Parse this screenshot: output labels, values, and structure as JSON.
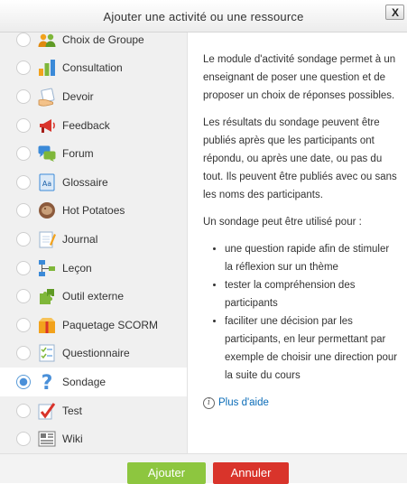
{
  "dialog": {
    "title": "Ajouter une activité ou une ressource",
    "close_label": "X"
  },
  "items": [
    {
      "label": "Choix de Groupe",
      "icon": "group-choice-icon",
      "selected": false
    },
    {
      "label": "Consultation",
      "icon": "bar-chart-icon",
      "selected": false
    },
    {
      "label": "Devoir",
      "icon": "hand-paper-icon",
      "selected": false
    },
    {
      "label": "Feedback",
      "icon": "megaphone-icon",
      "selected": false
    },
    {
      "label": "Forum",
      "icon": "chat-bubbles-icon",
      "selected": false
    },
    {
      "label": "Glossaire",
      "icon": "dictionary-icon",
      "selected": false
    },
    {
      "label": "Hot Potatoes",
      "icon": "potato-icon",
      "selected": false
    },
    {
      "label": "Journal",
      "icon": "notebook-icon",
      "selected": false
    },
    {
      "label": "Leçon",
      "icon": "flowchart-icon",
      "selected": false
    },
    {
      "label": "Outil externe",
      "icon": "puzzle-icon",
      "selected": false
    },
    {
      "label": "Paquetage SCORM",
      "icon": "package-icon",
      "selected": false
    },
    {
      "label": "Questionnaire",
      "icon": "checklist-icon",
      "selected": false
    },
    {
      "label": "Sondage",
      "icon": "question-mark-icon",
      "selected": true
    },
    {
      "label": "Test",
      "icon": "checkmark-icon",
      "selected": false
    },
    {
      "label": "Wiki",
      "icon": "wiki-icon",
      "selected": false
    }
  ],
  "description": {
    "p1": "Le module d'activité sondage permet à un enseignant de poser une question et de proposer un choix de réponses possibles.",
    "p2": "Les résultats du sondage peuvent être publiés après que les participants ont répondu, ou après une date, ou pas du tout. Ils peuvent être publiés avec ou sans les noms des participants.",
    "p3": "Un sondage peut être utilisé pour :",
    "bullets": [
      "une question rapide afin de stimuler la réflexion sur un thème",
      "tester la compréhension des participants",
      "faciliter une décision par les participants, en leur permettant par exemple de choisir une direction pour la suite du cours"
    ],
    "help_label": "Plus d'aide"
  },
  "footer": {
    "add_label": "Ajouter",
    "cancel_label": "Annuler"
  },
  "colors": {
    "add": "#8dc63f",
    "cancel": "#d9342b",
    "link": "#0a6cb8",
    "radio_selected": "#4a90d9"
  }
}
